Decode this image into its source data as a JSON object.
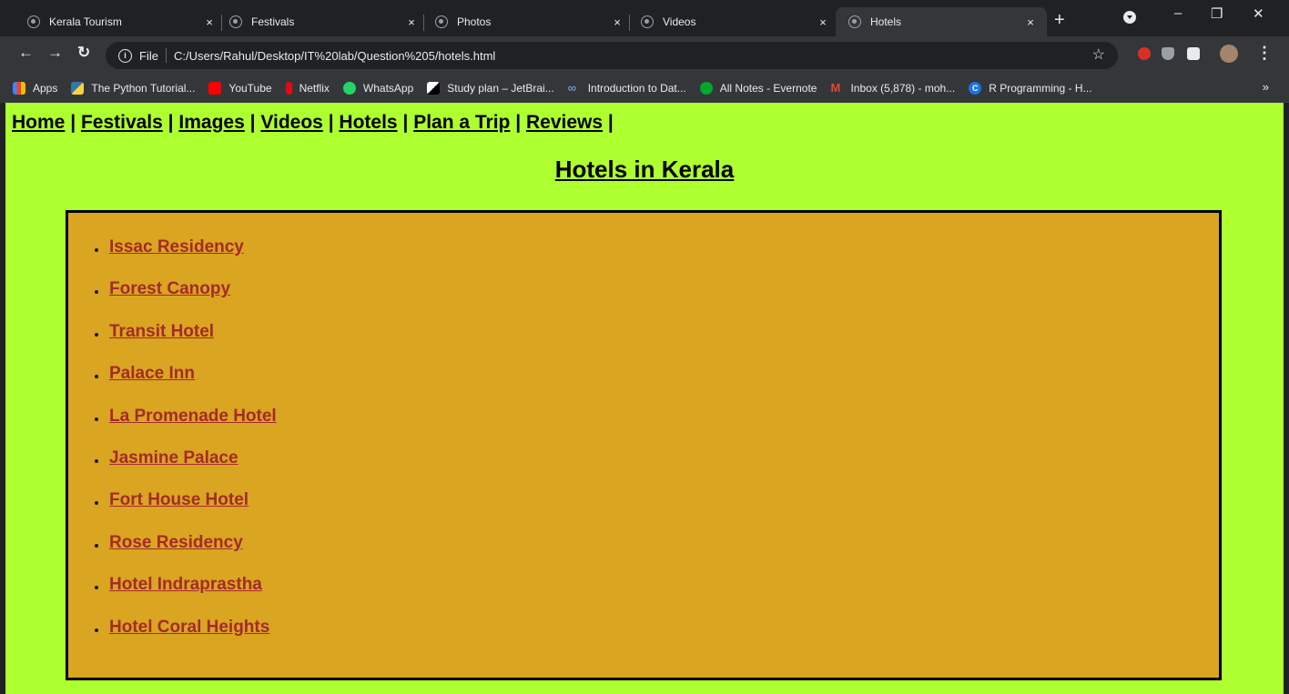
{
  "browser": {
    "tabs": [
      {
        "title": "Kerala Tourism",
        "active": false
      },
      {
        "title": "Festivals",
        "active": false
      },
      {
        "title": "Photos",
        "active": false
      },
      {
        "title": "Videos",
        "active": false
      },
      {
        "title": "Hotels",
        "active": true
      }
    ],
    "close_glyph": "×",
    "new_tab_glyph": "+",
    "address": {
      "scheme": "File",
      "url": "C:/Users/Rahul/Desktop/IT%20lab/Question%205/hotels.html"
    },
    "bookmarks": [
      {
        "label": "Apps",
        "icon": "apps-grid-icon",
        "color": "#4285f4"
      },
      {
        "label": "The Python Tutorial...",
        "icon": "python-icon",
        "color": "#ffd43b"
      },
      {
        "label": "YouTube",
        "icon": "youtube-icon",
        "color": "#ff0000"
      },
      {
        "label": "Netflix",
        "icon": "netflix-icon",
        "color": "#e50914"
      },
      {
        "label": "WhatsApp",
        "icon": "whatsapp-icon",
        "color": "#25d366"
      },
      {
        "label": "Study plan – JetBrai...",
        "icon": "jetbrains-icon",
        "color": "#ffffff"
      },
      {
        "label": "Introduction to Dat...",
        "icon": "infinity-icon",
        "color": "#8ab4f8"
      },
      {
        "label": "All Notes - Evernote",
        "icon": "evernote-icon",
        "color": "#00a82d"
      },
      {
        "label": "Inbox (5,878) - moh...",
        "icon": "gmail-icon",
        "color": "#ea4335"
      },
      {
        "label": "R Programming - H...",
        "icon": "r-programming-icon",
        "color": "#1a73e8"
      }
    ],
    "bookmarks_more": "»"
  },
  "page": {
    "background": "#adff2f",
    "nav_links": [
      "Home",
      "Festivals",
      "Images",
      "Videos",
      "Hotels",
      "Plan a Trip",
      "Reviews"
    ],
    "nav_separator": "|",
    "title": "Hotels in Kerala",
    "box_background": "#daa520",
    "link_color": "#a52a2a",
    "hotels": [
      "Issac Residency",
      "Forest Canopy",
      "Transit Hotel",
      "Palace Inn",
      "La Promenade Hotel",
      "Jasmine Palace",
      "Fort House Hotel",
      "Rose Residency",
      "Hotel Indraprastha",
      "Hotel Coral Heights"
    ]
  }
}
